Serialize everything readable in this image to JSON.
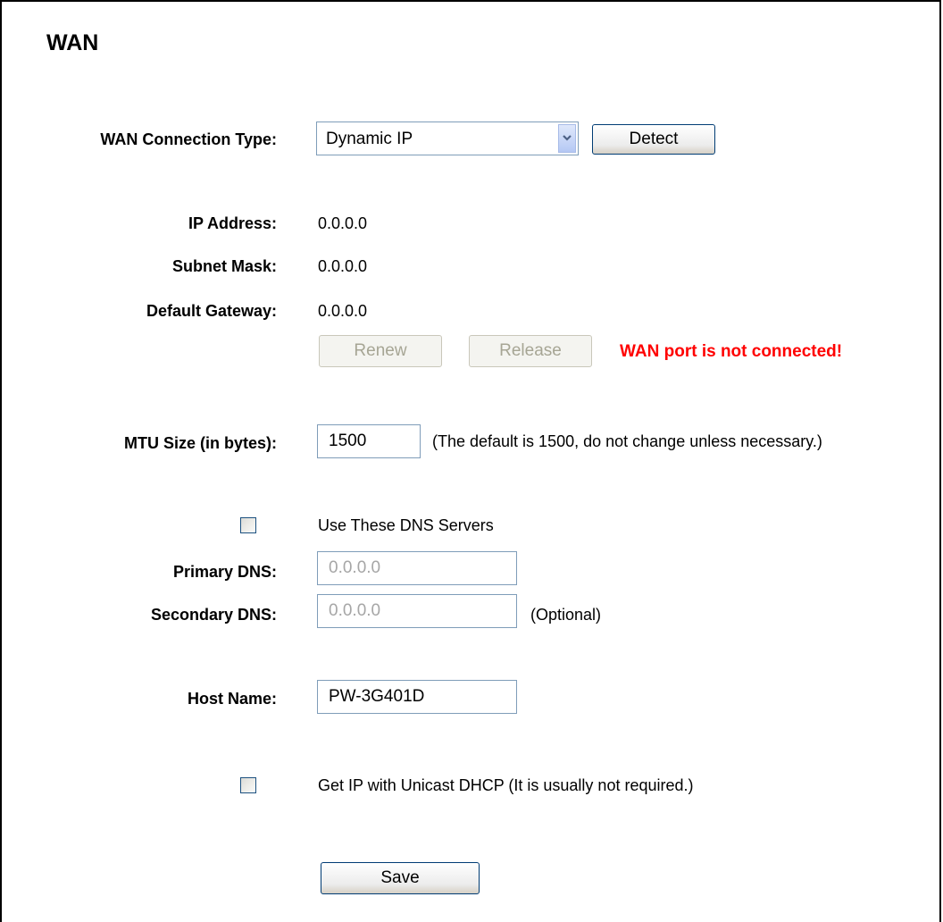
{
  "page": {
    "title": "WAN"
  },
  "connection": {
    "label": "WAN Connection Type:",
    "selected": "Dynamic IP",
    "detect_label": "Detect"
  },
  "status": {
    "ip_label": "IP Address:",
    "ip_value": "0.0.0.0",
    "mask_label": "Subnet Mask:",
    "mask_value": "0.0.0.0",
    "gateway_label": "Default Gateway:",
    "gateway_value": "0.0.0.0",
    "renew_label": "Renew",
    "release_label": "Release",
    "error_text": "WAN port is not connected!"
  },
  "mtu": {
    "label": "MTU Size (in bytes):",
    "value": "1500",
    "hint": "(The default is 1500, do not change unless necessary.)"
  },
  "dns": {
    "checkbox_label": "Use These DNS Servers",
    "checked": false,
    "primary_label": "Primary DNS:",
    "primary_value": "0.0.0.0",
    "secondary_label": "Secondary DNS:",
    "secondary_value": "0.0.0.0",
    "secondary_hint": "(Optional)"
  },
  "host": {
    "label": "Host Name:",
    "value": "PW-3G401D"
  },
  "unicast": {
    "checkbox_label": "Get IP with Unicast DHCP (It is usually not required.)",
    "checked": false
  },
  "actions": {
    "save_label": "Save"
  }
}
